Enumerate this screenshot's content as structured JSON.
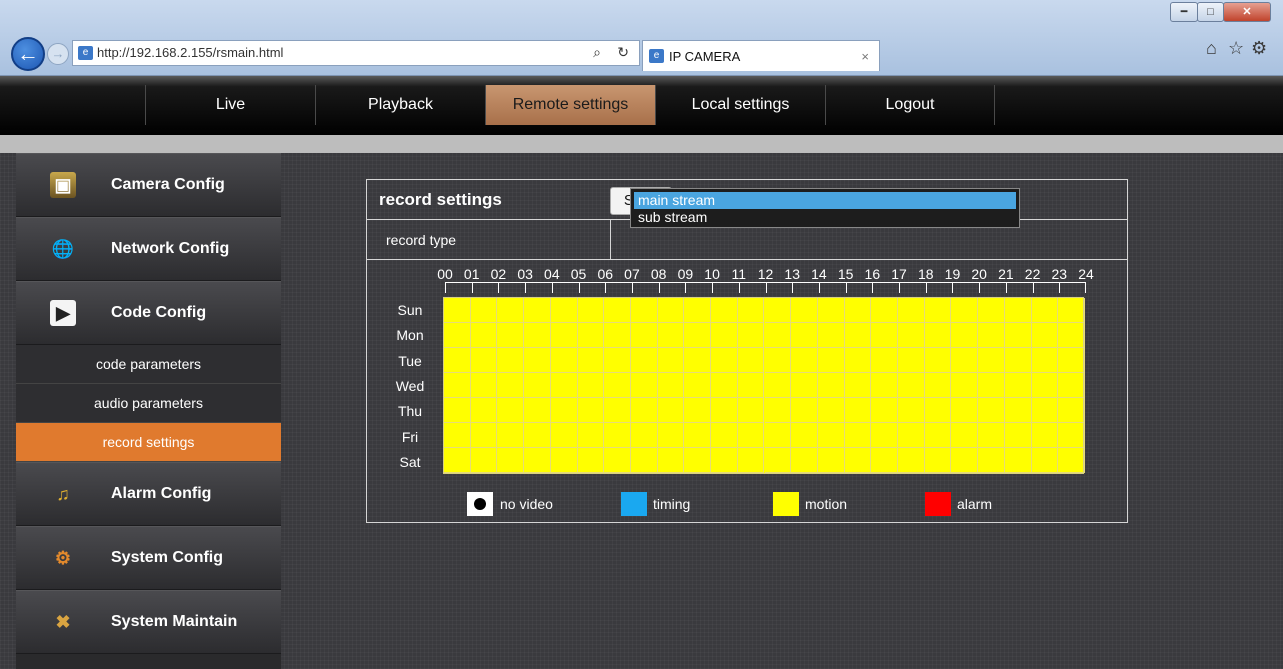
{
  "browser": {
    "url": "http://192.168.2.155/rsmain.html",
    "url_host": "192.168.2.155",
    "tab_title": "IP CAMERA",
    "search_glyph": "⌕",
    "refresh_glyph": "↻",
    "close_glyph": "×"
  },
  "nav": {
    "items": [
      {
        "label": "Live"
      },
      {
        "label": "Playback"
      },
      {
        "label": "Remote settings",
        "active": true
      },
      {
        "label": "Local settings"
      },
      {
        "label": "Logout"
      }
    ]
  },
  "sidebar": {
    "items": [
      {
        "label": "Camera Config",
        "icon": "monitor-icon"
      },
      {
        "label": "Network Config",
        "icon": "globe-icon"
      },
      {
        "label": "Code Config",
        "icon": "clapper-icon"
      },
      {
        "label": "Alarm Config",
        "icon": "alarm-icon"
      },
      {
        "label": "System Config",
        "icon": "settings-icon"
      },
      {
        "label": "System Maintain",
        "icon": "tools-icon"
      }
    ],
    "subitems": [
      {
        "label": "code parameters"
      },
      {
        "label": "audio parameters"
      },
      {
        "label": "record settings",
        "active": true
      }
    ]
  },
  "panel": {
    "title": "record settings",
    "save_label": "Save",
    "record_type_label": "record type",
    "record_type_options": [
      {
        "label": "main stream",
        "selected": true
      },
      {
        "label": "sub stream"
      }
    ],
    "hours": [
      "00",
      "01",
      "02",
      "03",
      "04",
      "05",
      "06",
      "07",
      "08",
      "09",
      "10",
      "11",
      "12",
      "13",
      "14",
      "15",
      "16",
      "17",
      "18",
      "19",
      "20",
      "21",
      "22",
      "23",
      "24"
    ],
    "days": [
      "Sun",
      "Mon",
      "Tue",
      "Wed",
      "Thu",
      "Fri",
      "Sat"
    ],
    "schedule_fill": "motion",
    "legend": [
      {
        "label": "no video",
        "color": "#ffffff"
      },
      {
        "label": "timing",
        "color": "#1aa8f0"
      },
      {
        "label": "motion",
        "color": "#ffff00"
      },
      {
        "label": "alarm",
        "color": "#ff0000"
      }
    ]
  }
}
